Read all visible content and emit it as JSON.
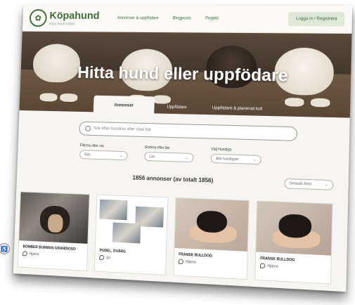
{
  "header": {
    "logo_text": "Köpahund",
    "logo_sub": "köpa hund online",
    "nav": [
      "Annonser & uppfödare",
      "Blogposts",
      "Projekt"
    ],
    "login_label": "Logga in / Registrera"
  },
  "hero": {
    "title": "Hitta hund eller uppfödare",
    "tabs": [
      "Annonser",
      "Uppfödare",
      "Uppfödare & planerad kull"
    ]
  },
  "search": {
    "placeholder": "Sök efter hundras eller stad här"
  },
  "filters": [
    {
      "label": "Filtrera efter ras",
      "value": "Ras"
    },
    {
      "label": "Sortera efter län",
      "value": "Län"
    },
    {
      "label": "Välj Hundtyp",
      "value": "Alla hundtyper"
    }
  ],
  "results": {
    "count_text": "1856 annonser (av totalt 1856)",
    "sort_value": "Senaste först"
  },
  "cards": [
    {
      "title": "Bomber Burman Grandioso",
      "location": "Hjärne"
    },
    {
      "title": "Pudel, Dvärg",
      "location": "Sn"
    },
    {
      "title": "Fransk Bulldog",
      "location": "Hjärne"
    },
    {
      "title": "Fransk Bulldog",
      "location": "Hjärne"
    }
  ],
  "colors": {
    "brand_green": "#3e6b3b",
    "background": "#f6f5f1"
  }
}
